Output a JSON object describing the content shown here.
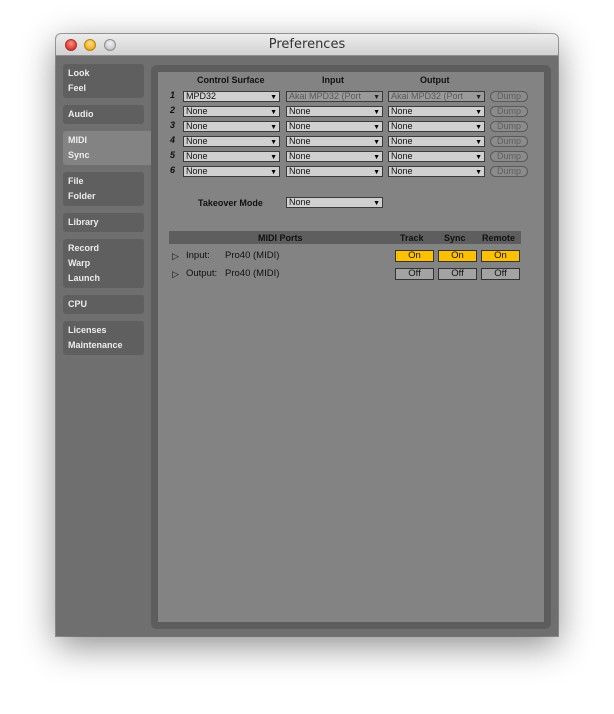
{
  "window": {
    "title": "Preferences"
  },
  "sidebar": {
    "tabs": [
      {
        "lines": [
          "Look",
          "Feel"
        ]
      },
      {
        "lines": [
          "Audio"
        ]
      },
      {
        "lines": [
          "MIDI",
          "Sync"
        ]
      },
      {
        "lines": [
          "File",
          "Folder"
        ]
      },
      {
        "lines": [
          "Library"
        ]
      },
      {
        "lines": [
          "Record",
          "Warp",
          "Launch"
        ]
      },
      {
        "lines": [
          "CPU"
        ]
      },
      {
        "lines": [
          "Licenses",
          "Maintenance"
        ]
      }
    ],
    "active": "MIDI Sync"
  },
  "midi": {
    "headers": {
      "control_surface": "Control Surface",
      "input": "Input",
      "output": "Output"
    },
    "rows": [
      {
        "num": "1",
        "surface": "MPD32",
        "input": "Akai MPD32 (Port",
        "output": "Akai MPD32 (Port",
        "dump": "Dump"
      },
      {
        "num": "2",
        "surface": "None",
        "input": "None",
        "output": "None",
        "dump": "Dump"
      },
      {
        "num": "3",
        "surface": "None",
        "input": "None",
        "output": "None",
        "dump": "Dump"
      },
      {
        "num": "4",
        "surface": "None",
        "input": "None",
        "output": "None",
        "dump": "Dump"
      },
      {
        "num": "5",
        "surface": "None",
        "input": "None",
        "output": "None",
        "dump": "Dump"
      },
      {
        "num": "6",
        "surface": "None",
        "input": "None",
        "output": "None",
        "dump": "Dump"
      }
    ],
    "takeover": {
      "label": "Takeover Mode",
      "value": "None"
    },
    "ports": {
      "header": {
        "title": "MIDI Ports",
        "track": "Track",
        "sync": "Sync",
        "remote": "Remote"
      },
      "rows": [
        {
          "direction": "Input:",
          "name": "Pro40 (MIDI)",
          "track": "On",
          "sync": "On",
          "remote": "On"
        },
        {
          "direction": "Output:",
          "name": "Pro40 (MIDI)",
          "track": "Off",
          "sync": "Off",
          "remote": "Off"
        }
      ]
    }
  },
  "colors": {
    "toggle_on": "#ffc000",
    "panel_bg": "#838383",
    "window_bg": "#6f6f6f"
  },
  "icons": {
    "dropdown": "dropdown-arrow-icon",
    "disclosure": "disclosure-triangle-icon"
  }
}
